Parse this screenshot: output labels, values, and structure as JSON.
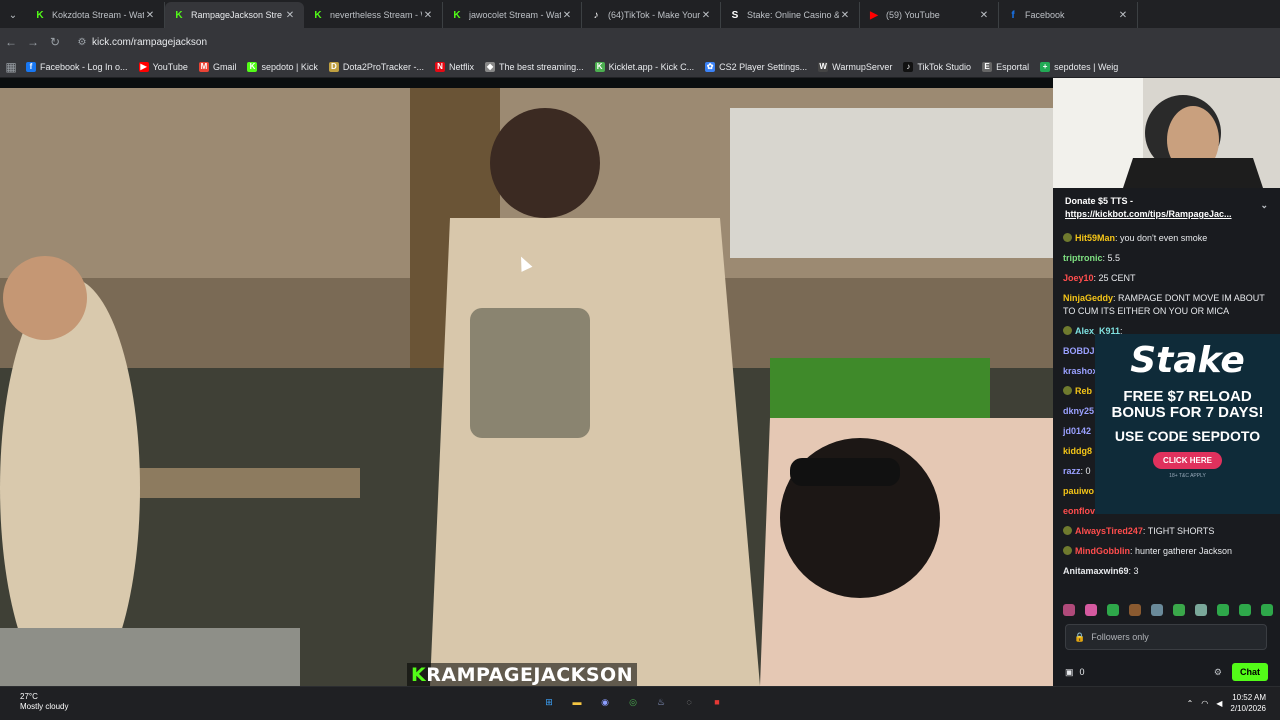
{
  "tabs": [
    {
      "title": "Kokzdota Stream - Watch",
      "fav": "K",
      "color": "#53fc18",
      "active": false
    },
    {
      "title": "RampageJackson Stre",
      "fav": "K",
      "color": "#53fc18",
      "active": true
    },
    {
      "title": "nevertheless Stream - Wa",
      "fav": "K",
      "color": "#53fc18",
      "active": false
    },
    {
      "title": "jawocolet Stream - Watch",
      "fav": "K",
      "color": "#53fc18",
      "active": false
    },
    {
      "title": "(64)TikTok - Make Your D",
      "fav": "♪",
      "color": "#ffffff",
      "active": false
    },
    {
      "title": "Stake: Online Casino & Sp",
      "fav": "S",
      "color": "#ffffff",
      "active": false
    },
    {
      "title": "(59) YouTube",
      "fav": "▶",
      "color": "#ff0000",
      "active": false
    },
    {
      "title": "Facebook",
      "fav": "f",
      "color": "#1877f2",
      "active": false
    }
  ],
  "url": "kick.com/rampagejackson",
  "bookmarks": [
    {
      "label": "Facebook - Log In o...",
      "fav": "f",
      "color": "#1877f2"
    },
    {
      "label": "YouTube",
      "fav": "▶",
      "color": "#ff0000"
    },
    {
      "label": "Gmail",
      "fav": "M",
      "color": "#ea4335"
    },
    {
      "label": "sepdoto | Kick",
      "fav": "K",
      "color": "#53fc18"
    },
    {
      "label": "Dota2ProTracker -...",
      "fav": "D",
      "color": "#c0a040"
    },
    {
      "label": "Netflix",
      "fav": "N",
      "color": "#e50914"
    },
    {
      "label": "The best streaming...",
      "fav": "◆",
      "color": "#888888"
    },
    {
      "label": "Kicklet.app - Kick C...",
      "fav": "K",
      "color": "#4caf50"
    },
    {
      "label": "CS2 Player Settings...",
      "fav": "✿",
      "color": "#3b82f6"
    },
    {
      "label": "WarmupServer",
      "fav": "W",
      "color": "#444444"
    },
    {
      "label": "TikTok Studio",
      "fav": "♪",
      "color": "#111111"
    },
    {
      "label": "Esportal",
      "fav": "E",
      "color": "#666666"
    },
    {
      "label": "sepdotes | Weig",
      "fav": "+",
      "color": "#22aa55"
    }
  ],
  "video": {
    "streamer_tag_k": "K",
    "streamer_tag": "RAMPAGEJACKSON"
  },
  "chat": {
    "pinned_title": "Donate $5 TTS -",
    "pinned_link": "https://kickbot.com/tips/RampageJac...",
    "messages": [
      {
        "user": "Hit59Man",
        "color": "#f5c518",
        "badge": true,
        "text": ": you don't even smoke"
      },
      {
        "user": "triptronic",
        "color": "#7ee081",
        "badge": false,
        "text": ": 5.5"
      },
      {
        "user": "Joey10",
        "color": "#ff4d4d",
        "badge": false,
        "text": ": 25 CENT"
      },
      {
        "user": "NinjaGeddy",
        "color": "#f5c518",
        "badge": false,
        "text": ": RAMPAGE DONT MOVE IM ABOUT TO CUM ITS EITHER ON YOU OR MICA"
      },
      {
        "user": "Alex_K911",
        "color": "#7ee0e0",
        "badge": true,
        "text": ":"
      },
      {
        "user": "BOBDJ",
        "color": "#9aa0ff",
        "badge": false,
        "text": ""
      },
      {
        "user": "krashox",
        "color": "#9aa0ff",
        "badge": false,
        "text": ""
      },
      {
        "user": "Reb",
        "color": "#f5c518",
        "badge": true,
        "text": ""
      },
      {
        "user": "dkny25",
        "color": "#9aa0ff",
        "badge": false,
        "text": ""
      },
      {
        "user": "jd0142",
        "color": "#9aa0ff",
        "badge": false,
        "text": ""
      },
      {
        "user": "kiddg8",
        "color": "#f5c518",
        "badge": false,
        "text": ""
      },
      {
        "user": "razz",
        "color": "#9aa0ff",
        "badge": false,
        "text": ": 0"
      },
      {
        "user": "pauiwo",
        "color": "#f5c518",
        "badge": false,
        "text": ""
      },
      {
        "user": "eonflov",
        "color": "#ff4d4d",
        "badge": false,
        "text": ""
      },
      {
        "user": "AlwaysTired247",
        "color": "#ff4d4d",
        "badge": true,
        "text": ": TIGHT SHORTS"
      },
      {
        "user": "MindGobblin",
        "color": "#ff4d4d",
        "badge": true,
        "text": ": hunter gatherer Jackson"
      },
      {
        "user": "Anitamaxwin69",
        "color": "#e8eaed",
        "badge": false,
        "text": ": 3"
      }
    ],
    "ad": {
      "logo": "Stake",
      "line1": "FREE $7 RELOAD BONUS FOR 7 DAYS!",
      "line2": "USE CODE SEPDOTO",
      "button": "CLICK HERE",
      "tc": "18+ T&C APPLY"
    },
    "input_placeholder": "Followers only",
    "viewer_count": "0",
    "chat_button": "Chat"
  },
  "taskbar": {
    "temp": "27°C",
    "weather": "Mostly cloudy",
    "time": "10:52 AM",
    "date": "2/10/2026"
  }
}
